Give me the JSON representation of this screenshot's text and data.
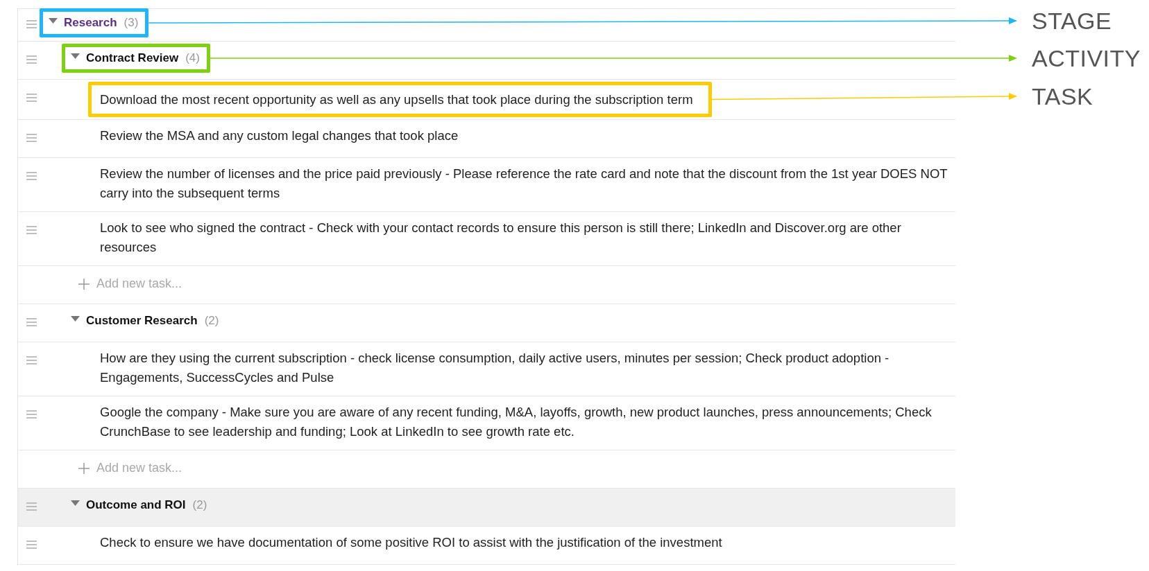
{
  "stages": [
    {
      "name": "Research",
      "count": "(3)",
      "expanded": true,
      "callout": {
        "label": "STAGE",
        "color": "#1fb6f7"
      },
      "activities": [
        {
          "name": "Contract Review",
          "count": "(4)",
          "expanded": true,
          "selected": false,
          "callout": {
            "label": "ACTIVITY",
            "color": "#7dd10f"
          },
          "tasks": [
            {
              "text": "Download the most recent opportunity as well as any upsells that took place during the subscription term",
              "callout": {
                "label": "TASK",
                "color": "#ffcc00"
              }
            },
            {
              "text": "Review the MSA and any custom legal changes that took place"
            },
            {
              "text": "Review the number of licenses and the price paid previously - Please reference the rate card and note that the discount from the 1st year DOES NOT carry into the subsequent terms"
            },
            {
              "text": "Look to see who signed the contract - Check with your contact records to ensure this person is still there; LinkedIn and Discover.org are other resources"
            }
          ],
          "add_task": "Add new task..."
        },
        {
          "name": "Customer Research",
          "count": "(2)",
          "expanded": true,
          "selected": false,
          "tasks": [
            {
              "text": "How are they using the current subscription - check license consumption, daily active users, minutes per session; Check product adoption - Engagements, SuccessCycles and Pulse"
            },
            {
              "text": "Google the company - Make sure you are aware of any recent funding, M&A, layoffs, growth, new product launches, press announcements; Check CrunchBase to see leadership and funding; Look at LinkedIn to see growth rate etc."
            }
          ],
          "add_task": "Add new task..."
        },
        {
          "name": "Outcome and ROI",
          "count": "(2)",
          "expanded": true,
          "selected": true,
          "tasks": [
            {
              "text": "Check to ensure we have documentation of some positive ROI to assist with the justification of the investment"
            }
          ]
        }
      ]
    }
  ]
}
